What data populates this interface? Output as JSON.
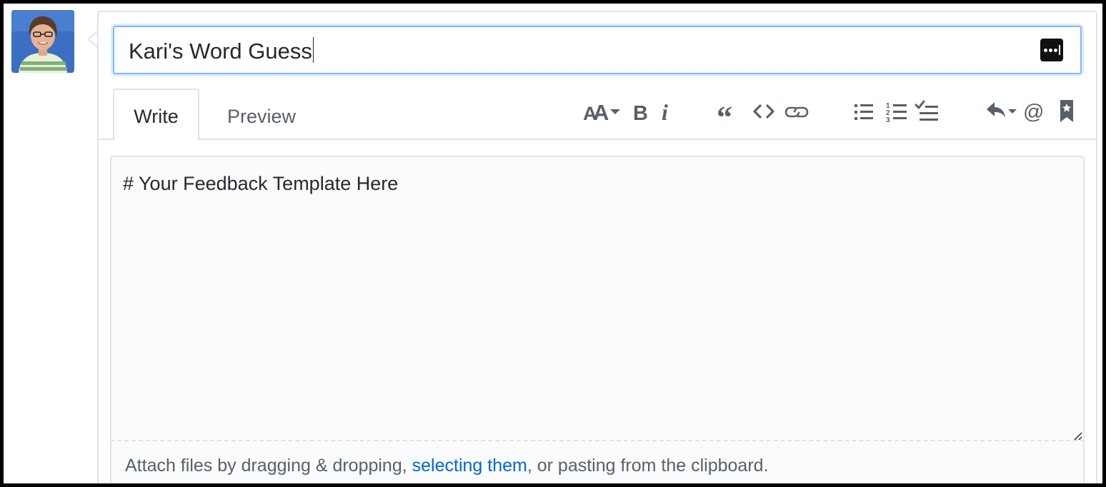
{
  "issue_title": {
    "value": "Kari's Word Guess",
    "password_manager_icon": "password-manager-icon"
  },
  "tabs": [
    {
      "label": "Write",
      "selected": true
    },
    {
      "label": "Preview",
      "selected": false
    }
  ],
  "toolbar": [
    {
      "name": "header",
      "icon": "text-size-icon"
    },
    {
      "name": "bold",
      "icon": "bold-icon"
    },
    {
      "name": "italic",
      "icon": "italic-icon"
    },
    {
      "name": "quote",
      "icon": "quote-icon"
    },
    {
      "name": "code",
      "icon": "code-icon"
    },
    {
      "name": "link",
      "icon": "link-icon"
    },
    {
      "name": "unordered-list",
      "icon": "list-unordered-icon"
    },
    {
      "name": "ordered-list",
      "icon": "list-ordered-icon"
    },
    {
      "name": "task-list",
      "icon": "tasklist-icon"
    },
    {
      "name": "saved-replies",
      "icon": "reply-icon"
    },
    {
      "name": "mention",
      "icon": "mention-icon"
    },
    {
      "name": "reference",
      "icon": "bookmark-icon"
    }
  ],
  "editor": {
    "body": "# Your Feedback Template Here"
  },
  "attach": {
    "prefix": "Attach files by dragging & dropping, ",
    "link": "selecting them",
    "suffix": ", or pasting from the clipboard."
  },
  "colors": {
    "accent": "#0366d6",
    "focus_border": "#79b8ff",
    "border": "#e1e4e8",
    "text": "#24292e",
    "muted": "#586069"
  }
}
